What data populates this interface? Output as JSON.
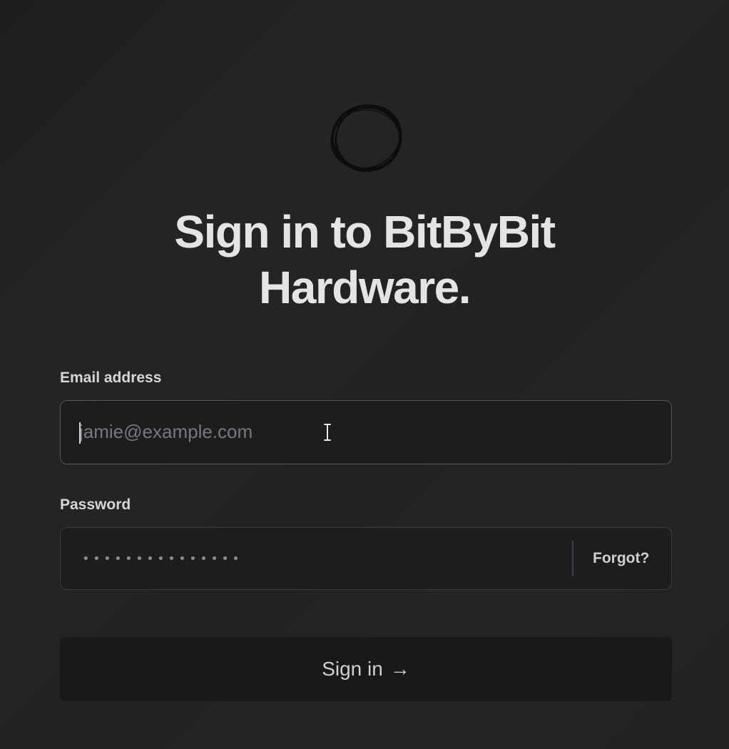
{
  "title": {
    "line1": "Sign in to BitByBit",
    "line2": "Hardware."
  },
  "logo": {
    "icon": "scribble-circle-logo"
  },
  "email": {
    "label": "Email address",
    "placeholder": "jamie@example.com",
    "value": ""
  },
  "password": {
    "label": "Password",
    "masked_value": "•••••••••••••••",
    "forgot_label": "Forgot?"
  },
  "signin": {
    "label": "Sign in",
    "arrow": "→"
  },
  "colors": {
    "background": "#212224",
    "field_background": "#1c1d1f",
    "button_background": "#18191b",
    "text": "#e4e4e4"
  }
}
